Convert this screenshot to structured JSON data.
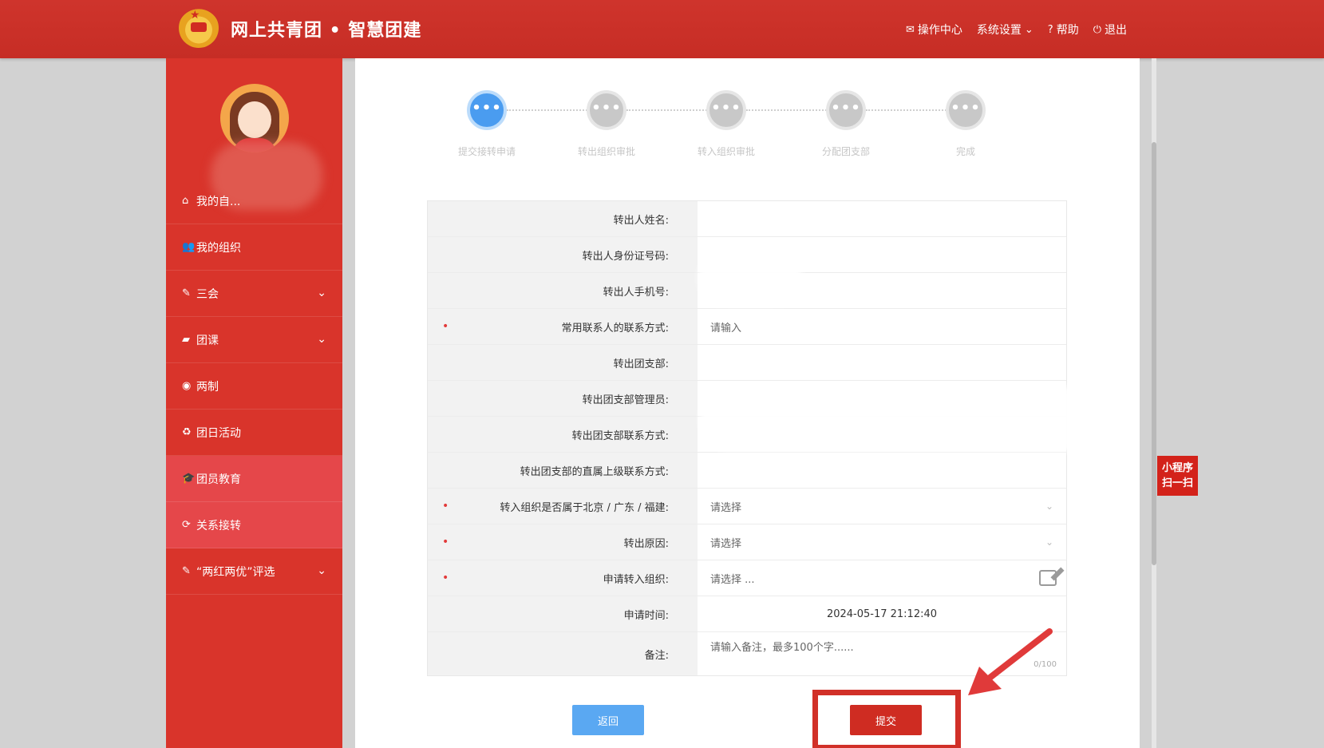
{
  "header": {
    "title": "网上共青团 • 智慧团建",
    "nav": [
      {
        "icon": "mail-icon",
        "label": "操作中心"
      },
      {
        "icon": "settings-dropdown",
        "label": "系统设置"
      },
      {
        "icon": "help-icon",
        "label": "帮助"
      },
      {
        "icon": "power-icon",
        "label": "退出"
      }
    ]
  },
  "sidebar": {
    "items": [
      {
        "icon": "home-icon",
        "label": "我的自...",
        "active": false
      },
      {
        "icon": "users-icon",
        "label": "我的组织",
        "active": false
      },
      {
        "icon": "edit-square-icon",
        "label": "三会",
        "active": false,
        "expandable": true
      },
      {
        "icon": "folder-icon",
        "label": "团课",
        "active": false,
        "expandable": true
      },
      {
        "icon": "target-icon",
        "label": "两制",
        "active": false
      },
      {
        "icon": "recycle-icon",
        "label": "团日活动",
        "active": false
      },
      {
        "icon": "graduation-cap-icon",
        "label": "团员教育",
        "active": true
      },
      {
        "icon": "refresh-icon",
        "label": "关系接转",
        "active": true
      },
      {
        "icon": "edit-square-icon",
        "label": "“两红两优”评选",
        "active": false,
        "expandable": true
      }
    ]
  },
  "steps": [
    {
      "label": "提交接转申请",
      "active": true
    },
    {
      "label": "转出组织审批",
      "active": false
    },
    {
      "label": "转入组织审批",
      "active": false
    },
    {
      "label": "分配团支部",
      "active": false
    },
    {
      "label": "完成",
      "active": false
    }
  ],
  "step_dots": "•••",
  "form": {
    "rows": [
      {
        "label": "转出人姓名:",
        "required": false,
        "value": ""
      },
      {
        "label": "转出人身份证号码:",
        "required": false,
        "value": ""
      },
      {
        "label": "转出人手机号:",
        "required": false,
        "value": ""
      },
      {
        "label": "常用联系人的联系方式:",
        "required": true,
        "placeholder": "请输入"
      },
      {
        "label": "转出团支部:",
        "required": false,
        "value": ""
      },
      {
        "label": "转出团支部管理员:",
        "required": false,
        "value": ""
      },
      {
        "label": "转出团支部联系方式:",
        "required": false,
        "value": ""
      },
      {
        "label": "转出团支部的直属上级联系方式:",
        "required": false,
        "value": ""
      },
      {
        "label": "转入组织是否属于北京 / 广东 / 福建:",
        "required": true,
        "placeholder": "请选择",
        "type": "select"
      },
      {
        "label": "转出原因:",
        "required": true,
        "placeholder": "请选择",
        "type": "select"
      },
      {
        "label": "申请转入组织:",
        "required": true,
        "placeholder": "请选择 ...",
        "type": "picker"
      },
      {
        "label": "申请时间:",
        "required": false,
        "value": "2024-05-17 21:12:40"
      },
      {
        "label": "备注:",
        "required": false,
        "placeholder": "请输入备注，最多100个字......",
        "type": "textarea",
        "counter": "0/100"
      }
    ],
    "required_mark": "•"
  },
  "buttons": {
    "back": "返回",
    "submit": "提交"
  },
  "mini_program": {
    "line1": "小程序",
    "line2": "扫一扫"
  },
  "colors": {
    "brand_red": "#cf342c",
    "active_step": "#4a9cf0",
    "back_button": "#5aa8f2",
    "submit_button": "#cf2c22"
  }
}
